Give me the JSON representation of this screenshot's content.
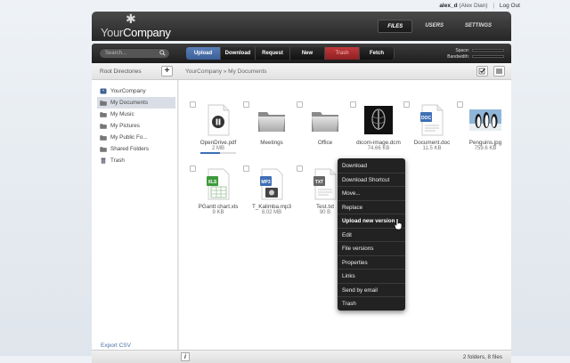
{
  "user": {
    "username": "alex_d",
    "fullname": "(Alex Dian)",
    "separator": "|",
    "logout": "Log Out"
  },
  "brand": {
    "part1": "Your",
    "part2": "Company"
  },
  "nav": {
    "tabs": [
      "FILES",
      "USERS",
      "SETTINGS"
    ],
    "active": "FILES"
  },
  "toolbar": {
    "search_placeholder": "Search...",
    "actions": [
      "Upload",
      "Download",
      "Request",
      "New",
      "Trash",
      "Fetch"
    ],
    "space_label": "Space:",
    "bandwidth_label": "Bandwidth:",
    "space_used": 0.0,
    "bandwidth_used": 0.0
  },
  "sidebar": {
    "heading": "Root Directories",
    "add_label": "+",
    "items": [
      {
        "label": "YourCompany",
        "icon": "company-icon"
      },
      {
        "label": "My Documents",
        "icon": "folder-icon",
        "selected": true
      },
      {
        "label": "My Music",
        "icon": "folder-icon"
      },
      {
        "label": "My Pictures",
        "icon": "folder-icon"
      },
      {
        "label": "My Public Fo...",
        "icon": "folder-icon"
      },
      {
        "label": "Shared Folders",
        "icon": "folder-icon"
      },
      {
        "label": "Trash",
        "icon": "trash-icon"
      }
    ],
    "export": "Export CSV"
  },
  "breadcrumb": "YourCompany » My Documents",
  "files": [
    {
      "name": "OpenDrive.pdf",
      "size": "2 MB",
      "icon": "pdf-icon",
      "progress": 0.55
    },
    {
      "name": "Meetings",
      "size": "",
      "icon": "folder-icon"
    },
    {
      "name": "Office",
      "size": "",
      "icon": "folder-icon"
    },
    {
      "name": "dicom-image.dcm",
      "size": "74.66 KB",
      "icon": "dicom-image-thumb"
    },
    {
      "name": "Document.doc",
      "size": "11.5 KB",
      "icon": "doc-icon"
    },
    {
      "name": "Penguins.jpg",
      "size": "759.6 KB",
      "icon": "penguins-image-thumb"
    },
    {
      "name": "PGantt chart.xls",
      "size": "9 KB",
      "icon": "xls-icon"
    },
    {
      "name": "T_Kalimba.mp3",
      "size": "8.02 MB",
      "icon": "mp3-icon"
    },
    {
      "name": "Test.txt",
      "size": "90 B",
      "icon": "txt-icon"
    }
  ],
  "context_menu": {
    "items": [
      "Download",
      "Download Shortcut",
      "Move...",
      "Replace",
      "Upload new version",
      "Edit",
      "File versions",
      "Properties",
      "Links",
      "Send by email",
      "Trash"
    ],
    "hovered": "Upload new version"
  },
  "footer": {
    "info": "i",
    "count": "2 folders, 8 files"
  }
}
